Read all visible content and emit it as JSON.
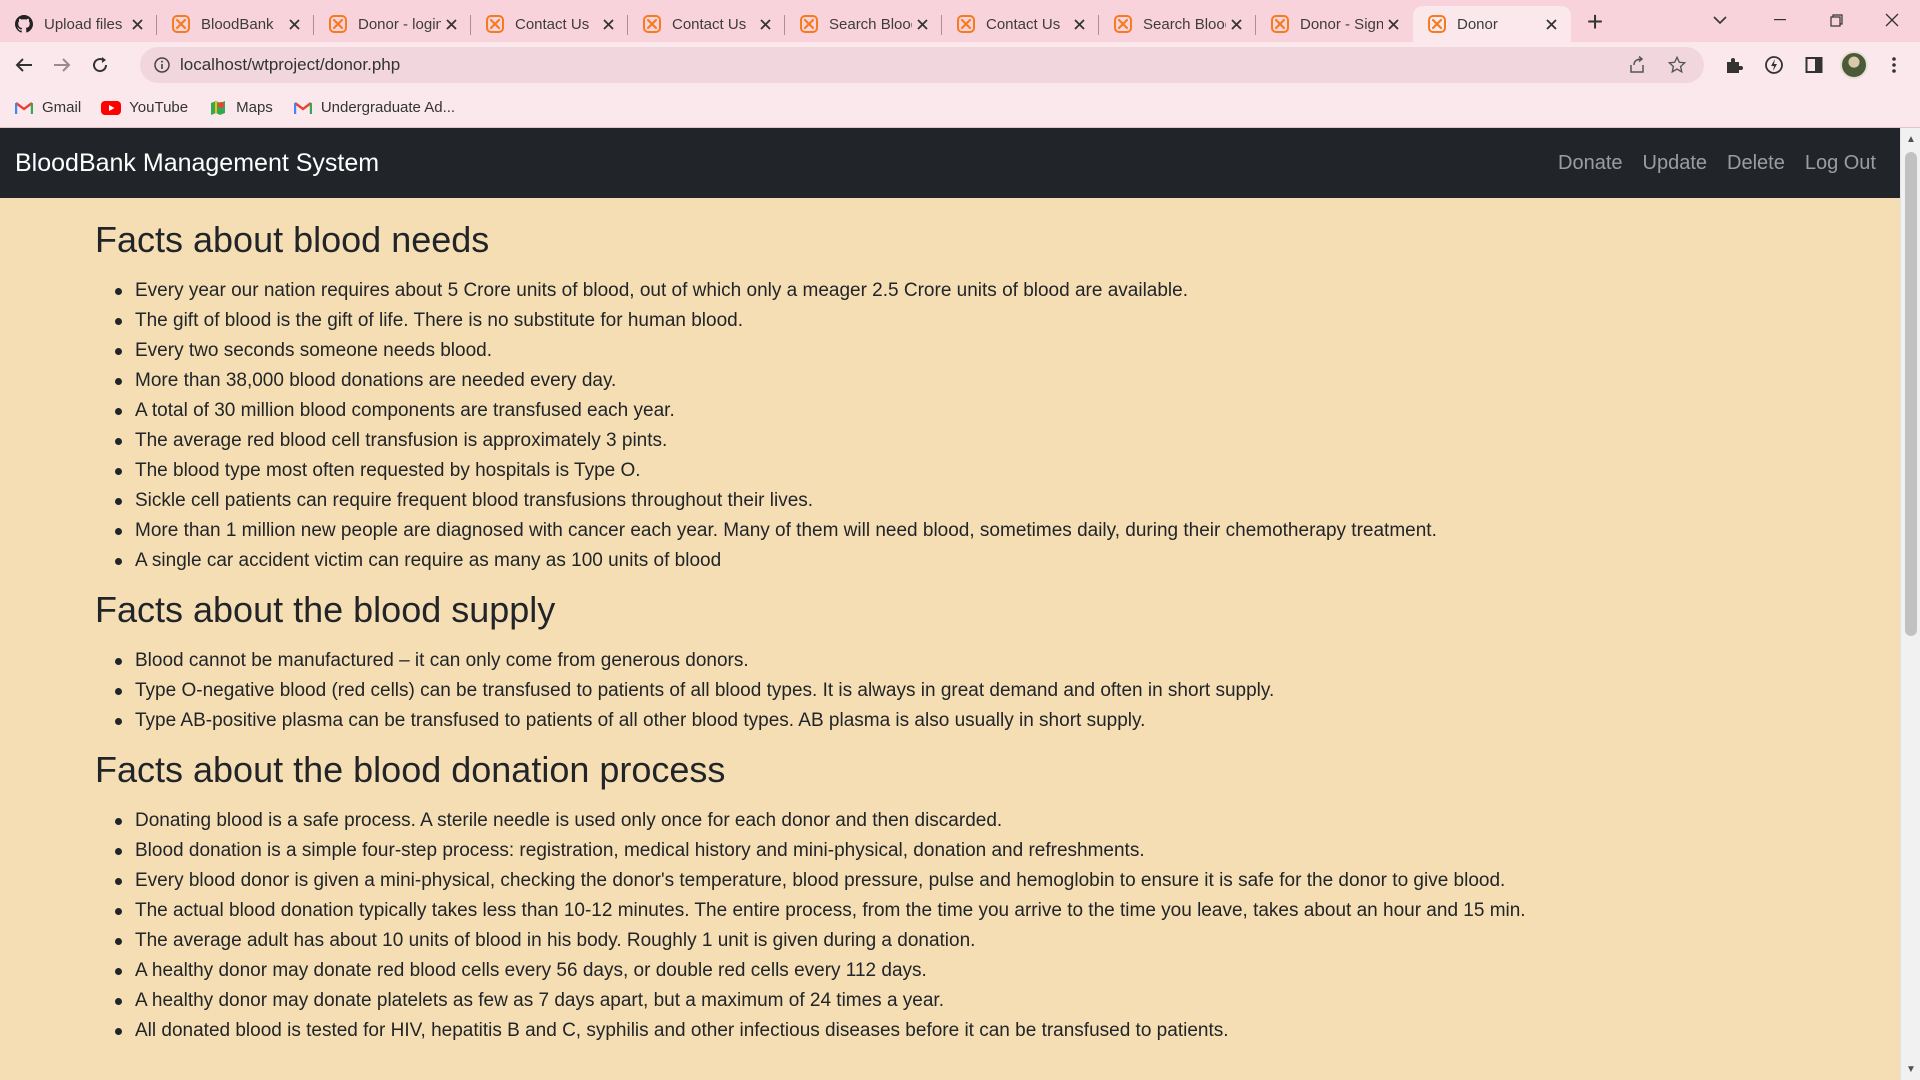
{
  "browser": {
    "tabs": [
      {
        "title": "Upload files",
        "icon": "github-icon",
        "active": false
      },
      {
        "title": "BloodBank",
        "icon": "xampp-icon",
        "active": false
      },
      {
        "title": "Donor - login",
        "icon": "xampp-icon",
        "active": false
      },
      {
        "title": "Contact Us",
        "icon": "xampp-icon",
        "active": false
      },
      {
        "title": "Contact Us",
        "icon": "xampp-icon",
        "active": false
      },
      {
        "title": "Search Blood",
        "icon": "xampp-icon",
        "active": false
      },
      {
        "title": "Contact Us",
        "icon": "xampp-icon",
        "active": false
      },
      {
        "title": "Search Blood",
        "icon": "xampp-icon",
        "active": false
      },
      {
        "title": "Donor - Sign",
        "icon": "xampp-icon",
        "active": false
      },
      {
        "title": "Donor",
        "icon": "xampp-icon",
        "active": true
      }
    ],
    "url": "localhost/wtproject/donor.php",
    "bookmarks": [
      {
        "label": "Gmail",
        "icon": "gmail-icon"
      },
      {
        "label": "YouTube",
        "icon": "youtube-icon"
      },
      {
        "label": "Maps",
        "icon": "maps-icon"
      },
      {
        "label": "Undergraduate Ad...",
        "icon": "gmail-icon"
      }
    ],
    "colors": {
      "tabbar": "#f9d3dc",
      "toolbar": "#fbe8ec",
      "xampp": "#f47c20"
    }
  },
  "navbar": {
    "brand": "BloodBank Management System",
    "links": [
      "Donate",
      "Update",
      "Delete",
      "Log Out"
    ]
  },
  "sections": [
    {
      "title": "Facts about blood needs",
      "items": [
        "Every year our nation requires about 5 Crore units of blood, out of which only a meager 2.5 Crore units of blood are available.",
        "The gift of blood is the gift of life. There is no substitute for human blood.",
        "Every two seconds someone needs blood.",
        "More than 38,000 blood donations are needed every day.",
        "A total of 30 million blood components are transfused each year.",
        "The average red blood cell transfusion is approximately 3 pints.",
        "The blood type most often requested by hospitals is Type O.",
        "Sickle cell patients can require frequent blood transfusions throughout their lives.",
        "More than 1 million new people are diagnosed with cancer each year. Many of them will need blood, sometimes daily, during their chemotherapy treatment.",
        "A single car accident victim can require as many as 100 units of blood"
      ]
    },
    {
      "title": "Facts about the blood supply",
      "items": [
        "Blood cannot be manufactured – it can only come from generous donors.",
        "Type O-negative blood (red cells) can be transfused to patients of all blood types. It is always in great demand and often in short supply.",
        "Type AB-positive plasma can be transfused to patients of all other blood types. AB plasma is also usually in short supply."
      ]
    },
    {
      "title": "Facts about the blood donation process",
      "items": [
        "Donating blood is a safe process. A sterile needle is used only once for each donor and then discarded.",
        "Blood donation is a simple four-step process: registration, medical history and mini-physical, donation and refreshments.",
        "Every blood donor is given a mini-physical, checking the donor's temperature, blood pressure, pulse and hemoglobin to ensure it is safe for the donor to give blood.",
        "The actual blood donation typically takes less than 10-12 minutes. The entire process, from the time you arrive to the time you leave, takes about an hour and 15 min.",
        "The average adult has about 10 units of blood in his body. Roughly 1 unit is given during a donation.",
        "A healthy donor may donate red blood cells every 56 days, or double red cells every 112 days.",
        "A healthy donor may donate platelets as few as 7 days apart, but a maximum of 24 times a year.",
        "All donated blood is tested for HIV, hepatitis B and C, syphilis and other infectious diseases before it can be transfused to patients."
      ]
    }
  ],
  "page_colors": {
    "background": "#f5deb3",
    "navbar": "#212529",
    "text": "#212529"
  }
}
